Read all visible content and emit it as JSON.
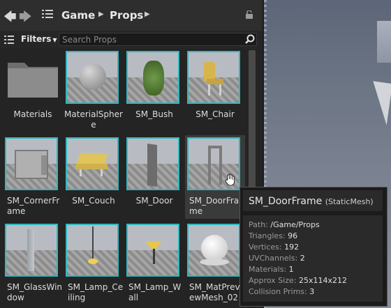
{
  "nav": {
    "back_icon": "back-arrow-icon",
    "forward_icon": "forward-arrow-icon",
    "path_icon": "folder-tree-icon",
    "crumbs": [
      "Game",
      "Props"
    ],
    "lock_icon": "lock-icon"
  },
  "filter": {
    "label": "Filters",
    "search_placeholder": "Search Props"
  },
  "assets": [
    {
      "label": "Materials",
      "kind": "folder"
    },
    {
      "label": "MaterialSphere",
      "kind": "sphere"
    },
    {
      "label": "SM_Bush",
      "kind": "bush"
    },
    {
      "label": "SM_Chair",
      "kind": "chair"
    },
    {
      "label": "SM_CornerFrame",
      "kind": "corner"
    },
    {
      "label": "SM_Couch",
      "kind": "couch"
    },
    {
      "label": "SM_Door",
      "kind": "door"
    },
    {
      "label": "SM_DoorFrame",
      "kind": "doorframe"
    },
    {
      "label": "SM_GlassWindow",
      "kind": "glass"
    },
    {
      "label": "SM_Lamp_Ceiling",
      "kind": "lampceil"
    },
    {
      "label": "SM_Lamp_Wall",
      "kind": "lampwall"
    },
    {
      "label": "SM_MatPreviewMesh_02",
      "kind": "matpreview"
    }
  ],
  "tooltip": {
    "title": "SM_DoorFrame",
    "type": "(StaticMesh)",
    "rows": [
      {
        "key": "Path:",
        "value": "/Game/Props"
      },
      {
        "key": "Triangles:",
        "value": "96"
      },
      {
        "key": "Vertices:",
        "value": "192"
      },
      {
        "key": "UVChannels:",
        "value": "2"
      },
      {
        "key": "Materials:",
        "value": "1"
      },
      {
        "key": "Approx Size:",
        "value": "25x114x212"
      },
      {
        "key": "Collision Prims:",
        "value": "3"
      }
    ]
  },
  "colors": {
    "accent": "#2fb8c1",
    "panel": "#242424"
  }
}
